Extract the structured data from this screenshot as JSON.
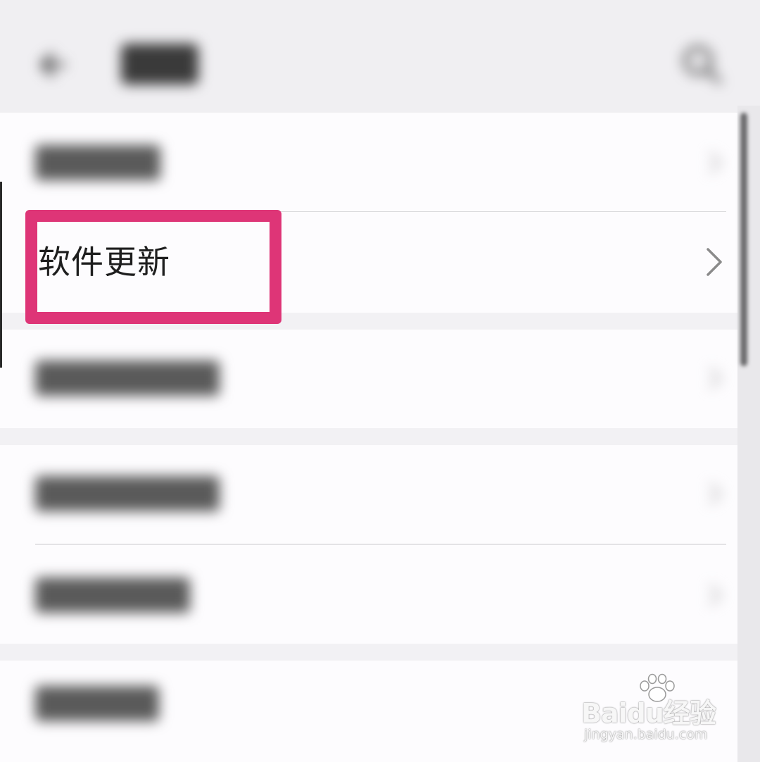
{
  "list": {
    "highlighted_item": {
      "label": "软件更新"
    }
  },
  "watermark": {
    "logo": "Baidu经验",
    "url": "jingyan.baidu.com"
  },
  "colors": {
    "highlight_border": "#de3577",
    "background": "#f2f1f4",
    "card": "#fdfcfe"
  },
  "icons": {
    "back": "arrow-left-icon",
    "search": "search-icon",
    "chevron": "chevron-right-icon",
    "watermark_paw": "paw-icon"
  }
}
